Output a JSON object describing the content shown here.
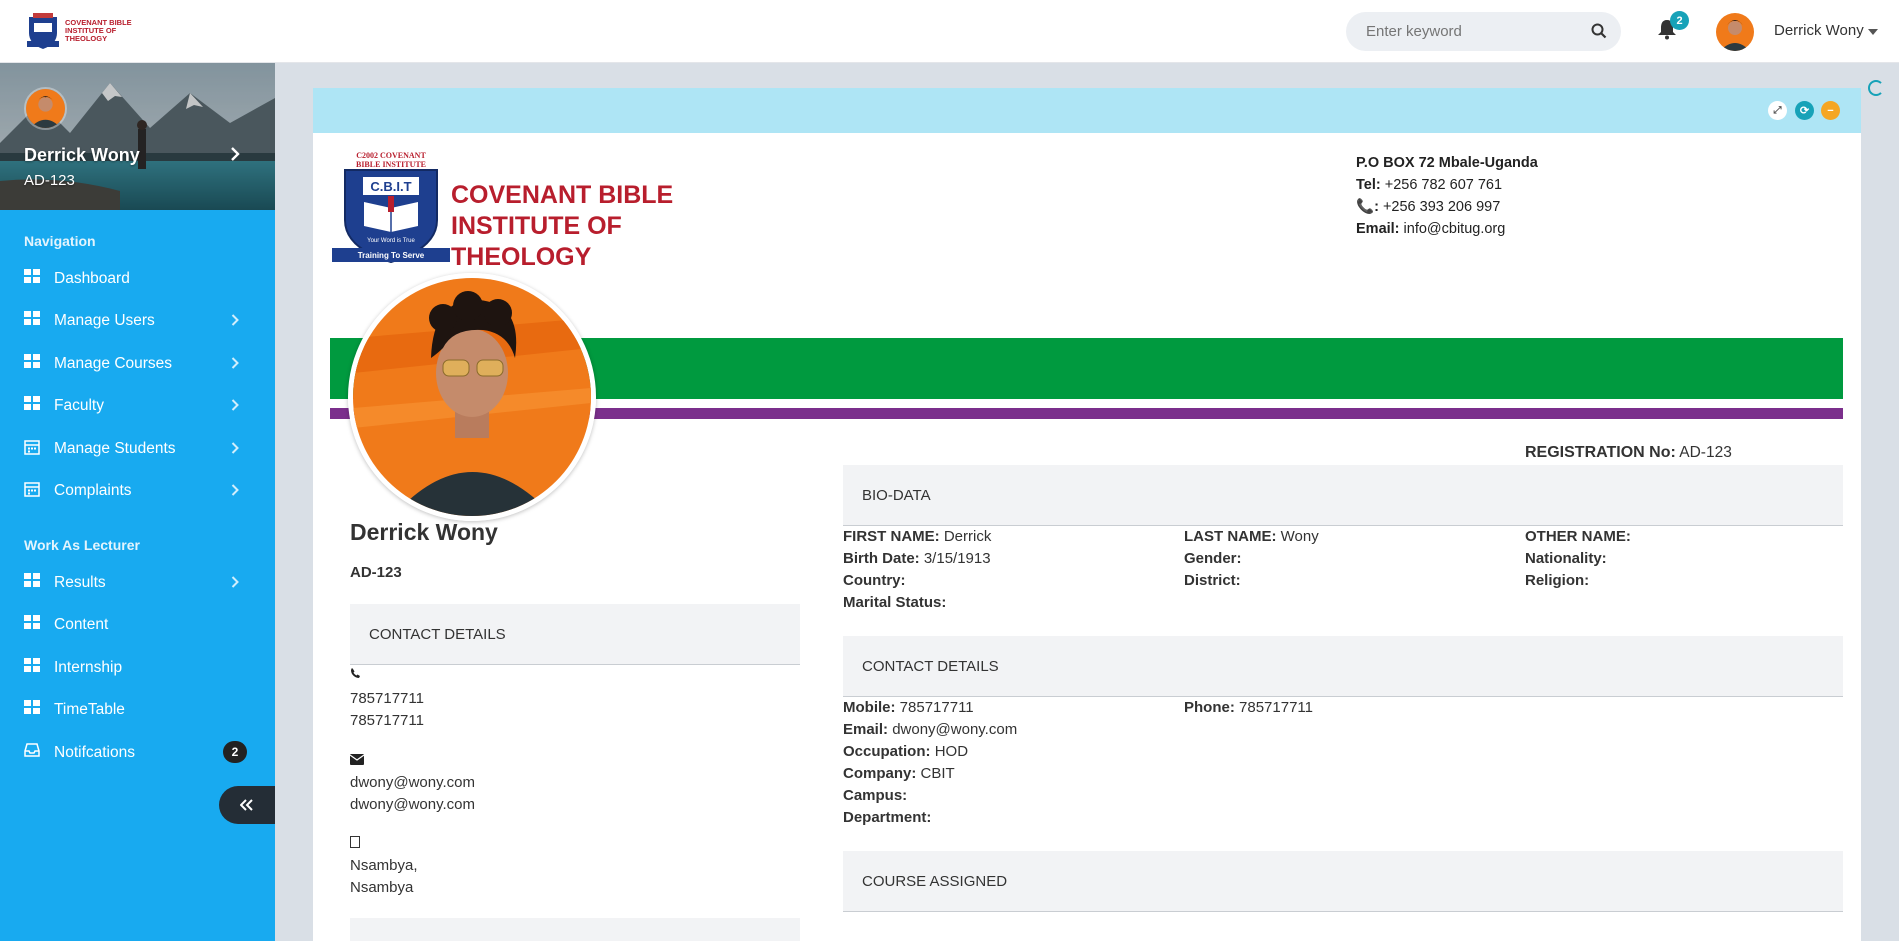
{
  "brand": {
    "name": "COVENANT BIBLE INSTITUTE OF THEOLOGY"
  },
  "topbar": {
    "search_placeholder": "Enter keyword",
    "notification_count": "2",
    "user_name": "Derrick Wony"
  },
  "sidebar": {
    "profile": {
      "name": "Derrick Wony",
      "reg": "AD-123"
    },
    "navigation_heading": "Navigation",
    "navigation": [
      {
        "label": "Dashboard",
        "icon": "grid-icon",
        "chevron": false
      },
      {
        "label": "Manage Users",
        "icon": "grid-icon",
        "chevron": true
      },
      {
        "label": "Manage Courses",
        "icon": "grid-icon",
        "chevron": true
      },
      {
        "label": "Faculty",
        "icon": "grid-icon",
        "chevron": true
      },
      {
        "label": "Manage Students",
        "icon": "calendar-icon",
        "chevron": true
      },
      {
        "label": "Complaints",
        "icon": "calendar-icon",
        "chevron": true
      }
    ],
    "lecturer_heading": "Work As Lecturer",
    "lecturer": [
      {
        "label": "Results",
        "icon": "grid-icon",
        "chevron": true
      },
      {
        "label": "Content",
        "icon": "grid-icon",
        "chevron": false
      },
      {
        "label": "Internship",
        "icon": "grid-icon",
        "chevron": false
      },
      {
        "label": "TimeTable",
        "icon": "grid-icon",
        "chevron": false
      },
      {
        "label": "Notifcations",
        "icon": "inbox-icon",
        "badge": "2"
      }
    ]
  },
  "letterhead": {
    "logo_text": [
      "C2002 COVENANT",
      "BIBLE INSTITUTE",
      "C.B.I.T",
      "Your Word is True",
      "Training To Serve"
    ],
    "institution": "COVENANT BIBLE INSTITUTE OF THEOLOGY",
    "address": "P.O BOX 72 Mbale-Uganda",
    "tel_label": "Tel:",
    "tel": "+256 782 607 761",
    "phone2_label": ":",
    "phone2": "+256 393 206 997",
    "email_label": "Email:",
    "email": "info@cbitug.org"
  },
  "student": {
    "name": "Derrick Wony",
    "reg": "AD-123",
    "registration_label": "REGISTRATION No:",
    "registration_no": "AD-123"
  },
  "contact_left": {
    "title": "CONTACT DETAILS",
    "phones": [
      "785717711",
      "785717711"
    ],
    "emails": [
      "dwony@wony.com",
      "dwony@wony.com"
    ],
    "addresses": [
      "Nsambya,",
      "Nsambya"
    ]
  },
  "bio": {
    "title": "BIO-DATA",
    "first_name_label": "FIRST NAME:",
    "first_name": "Derrick",
    "last_name_label": "LAST NAME:",
    "last_name": "Wony",
    "other_name_label": "OTHER NAME:",
    "other_name": "",
    "birth_date_label": "Birth Date:",
    "birth_date": "3/15/1913",
    "gender_label": "Gender:",
    "gender": "",
    "nationality_label": "Nationality:",
    "nationality": "",
    "country_label": "Country:",
    "country": "",
    "district_label": "District:",
    "district": "",
    "religion_label": "Religion:",
    "religion": "",
    "marital_label": "Marital Status:",
    "marital": ""
  },
  "contact": {
    "title": "CONTACT DETAILS",
    "mobile_label": "Mobile:",
    "mobile": "785717711",
    "phone_label": "Phone:",
    "phone": "785717711",
    "email_label": "Email:",
    "email": "dwony@wony.com",
    "occupation_label": "Occupation:",
    "occupation": "HOD",
    "company_label": "Company:",
    "company": "CBIT",
    "campus_label": "Campus:",
    "campus": "",
    "department_label": "Department:",
    "department": ""
  },
  "course": {
    "title": "COURSE ASSIGNED"
  },
  "colors": {
    "sidebar": "#18aaf0",
    "green_band": "#009a3f",
    "purple_band": "#7b2f8c",
    "card_header": "#aee5f5",
    "brand_red": "#b81e2d"
  }
}
